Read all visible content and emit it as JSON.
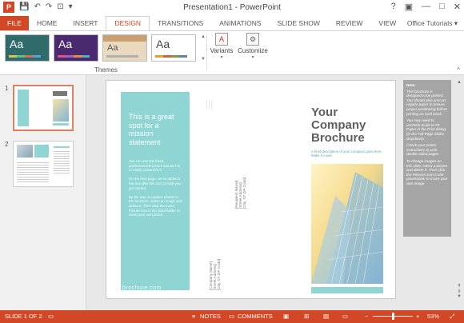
{
  "titlebar": {
    "title": "Presentation1 - PowerPoint",
    "help_icon": "?",
    "restore_icon": "▣",
    "minimize_icon": "—",
    "maximize_icon": "□",
    "close_icon": "✕"
  },
  "qat": {
    "logo": "P",
    "save": "💾",
    "undo": "↶",
    "redo": "↷",
    "start": "⊡",
    "more": "▾"
  },
  "tabs": [
    "FILE",
    "HOME",
    "INSERT",
    "DESIGN",
    "TRANSITIONS",
    "ANIMATIONS",
    "SLIDE SHOW",
    "REVIEW",
    "VIEW"
  ],
  "active_tab": "DESIGN",
  "account": "Office Tutorials ▾",
  "ribbon": {
    "theme_aa": [
      "Aa",
      "Aa",
      "Aa",
      "Aa"
    ],
    "themes_label": "Themes",
    "variants_label": "Variants",
    "customize_label": "Customize",
    "caret": "▾",
    "scroll_up": "▲",
    "scroll_down": "▼",
    "collapse": "^"
  },
  "thumbs": {
    "num1": "1",
    "num2": "2"
  },
  "slide": {
    "panel1_heading": "This is a great spot for a mission statement",
    "panel1_body": "You can use this fresh, professional brochure just as it is or easily customize it.\n\nOn the next page, we've added a few tips (like this one) to help you get started.\n\nBy the way, to replace photos in the brochure, select an image and delete it. Then click the Insert Picture icon in the placeholder to insert your own photo.",
    "panel1_foot": "brochure.com",
    "company_block_mid": "[Recipient Name]\n[Street Address]\n[City, ST ZIP Code]",
    "company_block_left": "[Company Name]\n[Street Address]\n[City, ST ZIP Code]",
    "cover_title": "Your Company Brochure",
    "cover_subtitle": "A brief description of your company goes here. Make it count.",
    "faint_mark": "|||"
  },
  "notes": {
    "label": "Note:",
    "paragraphs": [
      "This brochure is designed to be printed. You should also print on regular paper to ensure proper positioning before printing on card stock.",
      "You may need to uncheck Scale to Fit Paper in the Print dialog (in the Full Page Slides dropdown).",
      "Check your printer instructions to print double-sided pages.",
      "To change images on this slide, select a picture and delete it. Then click the Pictures icon in the placeholder to insert your own image."
    ]
  },
  "scroll": {
    "up": "▲",
    "down": "▼",
    "prev": "⇞",
    "next": "⇟"
  },
  "status": {
    "slide_of": "SLIDE 1 OF 2",
    "notes": "NOTES",
    "comments": "COMMENTS",
    "minus": "−",
    "plus": "+",
    "zoom": "53%"
  },
  "colors": {
    "accent": "#d24726",
    "teal": "#8ed5d3",
    "notes_bg": "#a5a5a5"
  }
}
